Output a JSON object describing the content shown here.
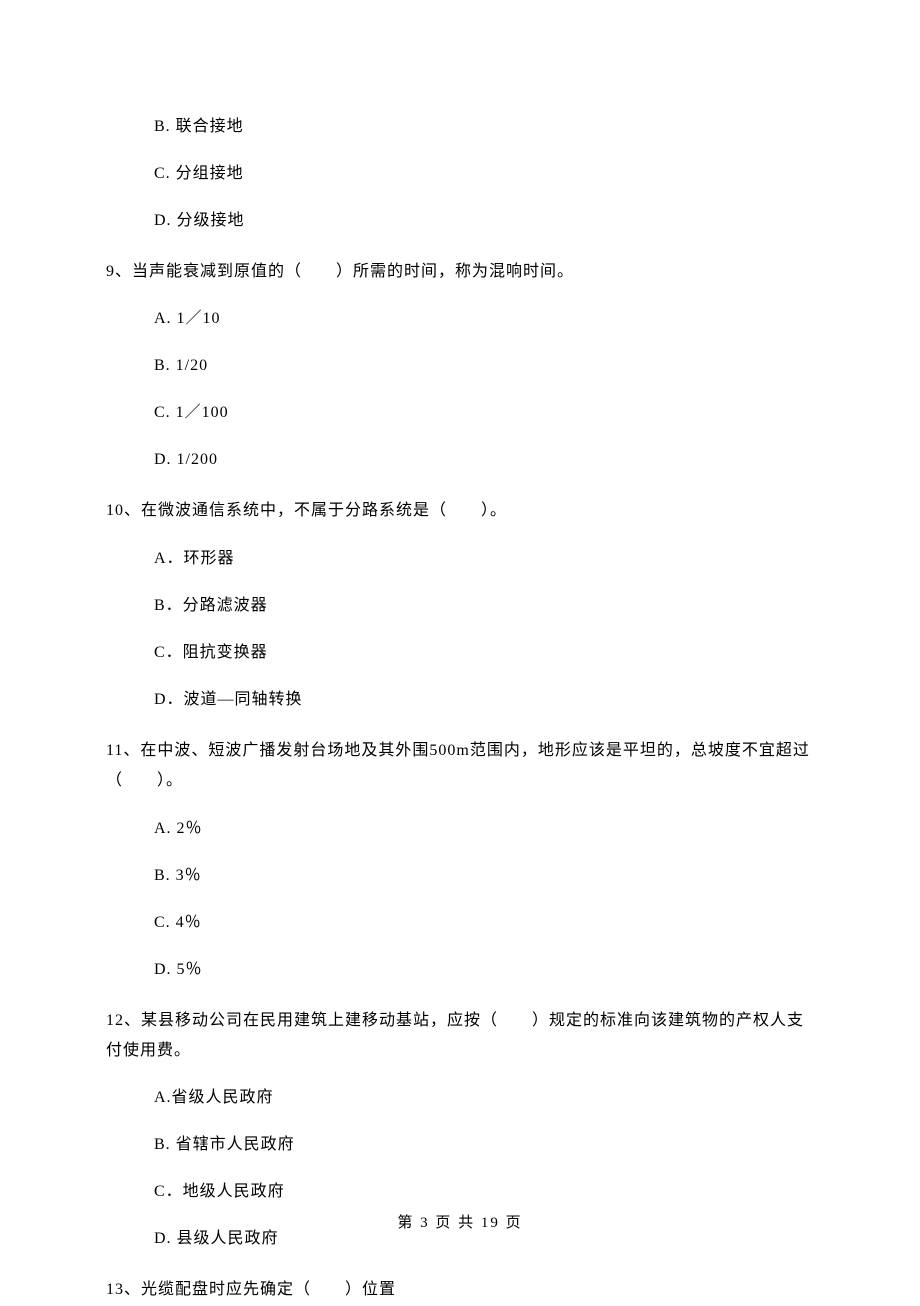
{
  "topOptions": {
    "B": "B. 联合接地",
    "C": "C. 分组接地",
    "D": "D. 分级接地"
  },
  "q9": {
    "stem": "9、当声能衰减到原值的（　　）所需的时间，称为混响时间。",
    "A": "A.  1／10",
    "B": "B.  1/20",
    "C": "C.  1／100",
    "D": "D.  1/200"
  },
  "q10": {
    "stem": "10、在微波通信系统中，不属于分路系统是（　　）。",
    "A": "A．环形器",
    "B": "B．分路滤波器",
    "C": "C．阻抗变换器",
    "D": "D．波道—同轴转换"
  },
  "q11": {
    "stem": "11、在中波、短波广播发射台场地及其外围500m范围内，地形应该是平坦的，总坡度不宜超过（　　）。",
    "A": "A.  2％",
    "B": "B.  3％",
    "C": "C.  4％",
    "D": "D.  5％"
  },
  "q12": {
    "stem": "12、某县移动公司在民用建筑上建移动基站，应按（　　）规定的标准向该建筑物的产权人支付使用费。",
    "A": "A.省级人民政府",
    "B": "B. 省辖市人民政府",
    "C": "C．地级人民政府",
    "D": "D. 县级人民政府"
  },
  "q13": {
    "stem": "13、光缆配盘时应先确定（　　）位置"
  },
  "footer": "第 3 页 共 19 页"
}
